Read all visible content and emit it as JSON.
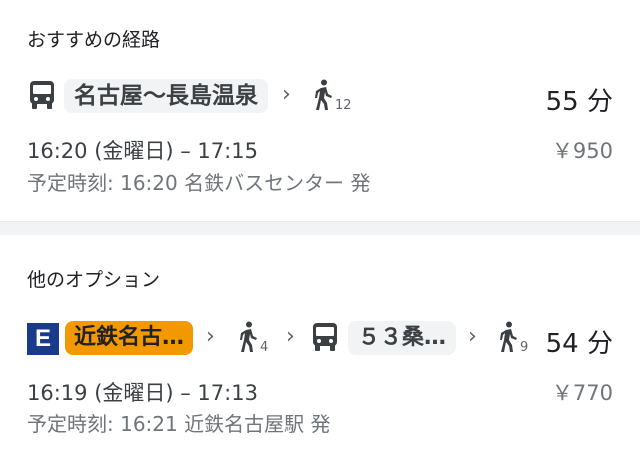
{
  "recommended": {
    "title": "おすすめの経路",
    "route_chip": "名古屋〜長島温泉",
    "walk_minutes": "12",
    "duration": "55 分",
    "times": "16:20 (金曜日) – 17:15",
    "price": "￥950",
    "schedule": "予定時刻: 16:20 名鉄バスセンター 発"
  },
  "other": {
    "title": "他のオプション",
    "line_badge": "E",
    "train_chip": "近鉄名古…",
    "walk1_minutes": "4",
    "bus_chip": "５３桑…",
    "walk2_minutes": "9",
    "duration": "54 分",
    "times": "16:19 (金曜日) – 17:13",
    "price": "￥770",
    "schedule": "予定時刻: 16:21 近鉄名古屋駅 発"
  },
  "icons": {
    "bus": "bus-icon",
    "walk": "walk-icon",
    "chevron": "chevron-right-icon"
  },
  "colors": {
    "train_chip": "#f29900",
    "line_badge": "#1a3a8c",
    "chip_gray": "#f1f3f4"
  }
}
